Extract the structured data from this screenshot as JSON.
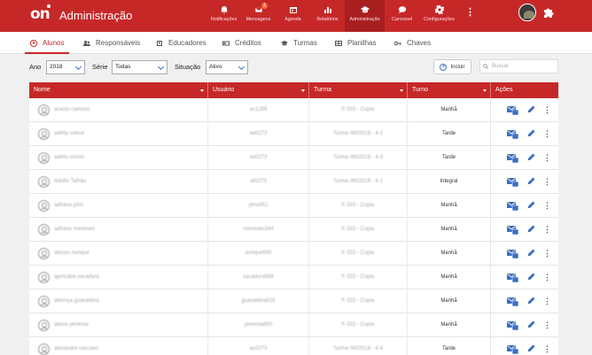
{
  "header": {
    "logo": "on",
    "title": "Administração",
    "nav": [
      {
        "label": "Notificações",
        "icon": "bell-icon"
      },
      {
        "label": "Mensagens",
        "icon": "mail-icon",
        "badge": "1"
      },
      {
        "label": "Agenda",
        "icon": "calendar-icon"
      },
      {
        "label": "Relatórios",
        "icon": "chart-icon"
      },
      {
        "label": "Administração",
        "icon": "graduation-cap-icon",
        "active": true
      },
      {
        "label": "Carrossel",
        "icon": "chat-icon"
      },
      {
        "label": "Configurações",
        "icon": "gear-icon"
      }
    ],
    "more_icon": "⋮"
  },
  "tabs": [
    {
      "label": "Alunos",
      "icon": "student-icon",
      "active": true
    },
    {
      "label": "Responsáveis",
      "icon": "people-icon"
    },
    {
      "label": "Educadores",
      "icon": "badge-icon"
    },
    {
      "label": "Créditos",
      "icon": "card-icon"
    },
    {
      "label": "Turmas",
      "icon": "graduation-cap-icon"
    },
    {
      "label": "Planilhas",
      "icon": "spreadsheet-icon"
    },
    {
      "label": "Chaves",
      "icon": "key-icon"
    }
  ],
  "filters": {
    "ano_label": "Ano",
    "ano_value": "2018",
    "serie_label": "Série",
    "serie_value": "Todas",
    "situacao_label": "Situação",
    "situacao_value": "Ativo",
    "incluir_label": "Incluir",
    "search_placeholder": "Buscar"
  },
  "table": {
    "columns": [
      "Nome",
      "Usuário",
      "Turma",
      "Turno",
      "Ações"
    ],
    "rows": [
      {
        "nome": "acacio caetano",
        "usuario": "ac1289",
        "turma": "F-333 - Copia",
        "turno": "Manhã"
      },
      {
        "nome": "adélia sobral",
        "usuario": "ao0273",
        "turma": "Turma 0802018 - 4-2",
        "turno": "Tarde"
      },
      {
        "nome": "adélio osório",
        "usuario": "ao0273",
        "turma": "Turma 0802018 - 4-3",
        "turno": "Tarde"
      },
      {
        "nome": "Adolfo Talhão",
        "usuario": "at0273",
        "turma": "Turma 0802018 - 4-1",
        "turno": "Integral"
      },
      {
        "nome": "adriana pino",
        "usuario": "pino361",
        "turma": "F-333 - Copia",
        "turno": "Manhã"
      },
      {
        "nome": "adriano meneses",
        "usuario": "meneses344",
        "turma": "F-333 - Copia",
        "turno": "Manhã"
      },
      {
        "nome": "afonso ourique",
        "usuario": "ourique595",
        "turma": "F-333 - Copia",
        "turno": "Manhã"
      },
      {
        "nome": "ajuricaba sacadura",
        "usuario": "sacadura948",
        "turma": "F-333 - Copia",
        "turno": "Manhã"
      },
      {
        "nome": "aldonça guaraldina",
        "usuario": "guaraldina815",
        "turma": "F-333 - Copia",
        "turno": "Manhã"
      },
      {
        "nome": "aleixo pimenta",
        "usuario": "pimenta850",
        "turma": "F-333 - Copia",
        "turno": "Manhã"
      },
      {
        "nome": "alexandre cascaes",
        "usuario": "ac0273",
        "turma": "Turma 0802018 - 4-4",
        "turno": "Tarde"
      }
    ]
  }
}
